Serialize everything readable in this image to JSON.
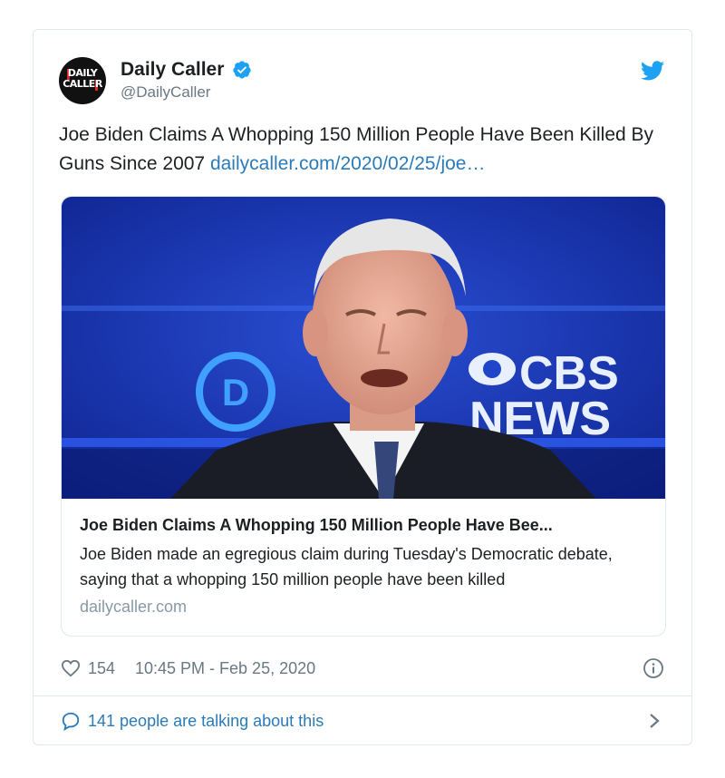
{
  "account": {
    "display_name": "Daily Caller",
    "handle": "@DailyCaller",
    "avatar_logo": "DAILY CALLER"
  },
  "tweet": {
    "text": "Joe Biden Claims A Whopping 150 Million People Have Been Killed By Guns Since 2007",
    "link_text": "dailycaller.com/2020/02/25/joe…"
  },
  "card": {
    "image_texts": {
      "network": "CBS",
      "network_sub": "NEWS",
      "logo_letter": "D"
    },
    "title": "Joe Biden Claims A Whopping 150 Million People Have Bee...",
    "description": "Joe Biden made an egregious claim during Tuesday's Democratic debate, saying that a whopping 150 million people have been killed",
    "domain": "dailycaller.com"
  },
  "meta": {
    "likes": "154",
    "timestamp": "10:45 PM - Feb 25, 2020"
  },
  "footer": {
    "talking_text": "141 people are talking about this"
  },
  "colors": {
    "link": "#2b7bb9",
    "verified": "#1da1f2",
    "twitter_brand": "#1da1f2",
    "muted": "#697882",
    "border": "#e1e8ed"
  },
  "icons": [
    "verified-badge-icon",
    "twitter-bird-icon",
    "heart-icon",
    "info-icon",
    "speech-bubble-icon",
    "chevron-right-icon"
  ]
}
